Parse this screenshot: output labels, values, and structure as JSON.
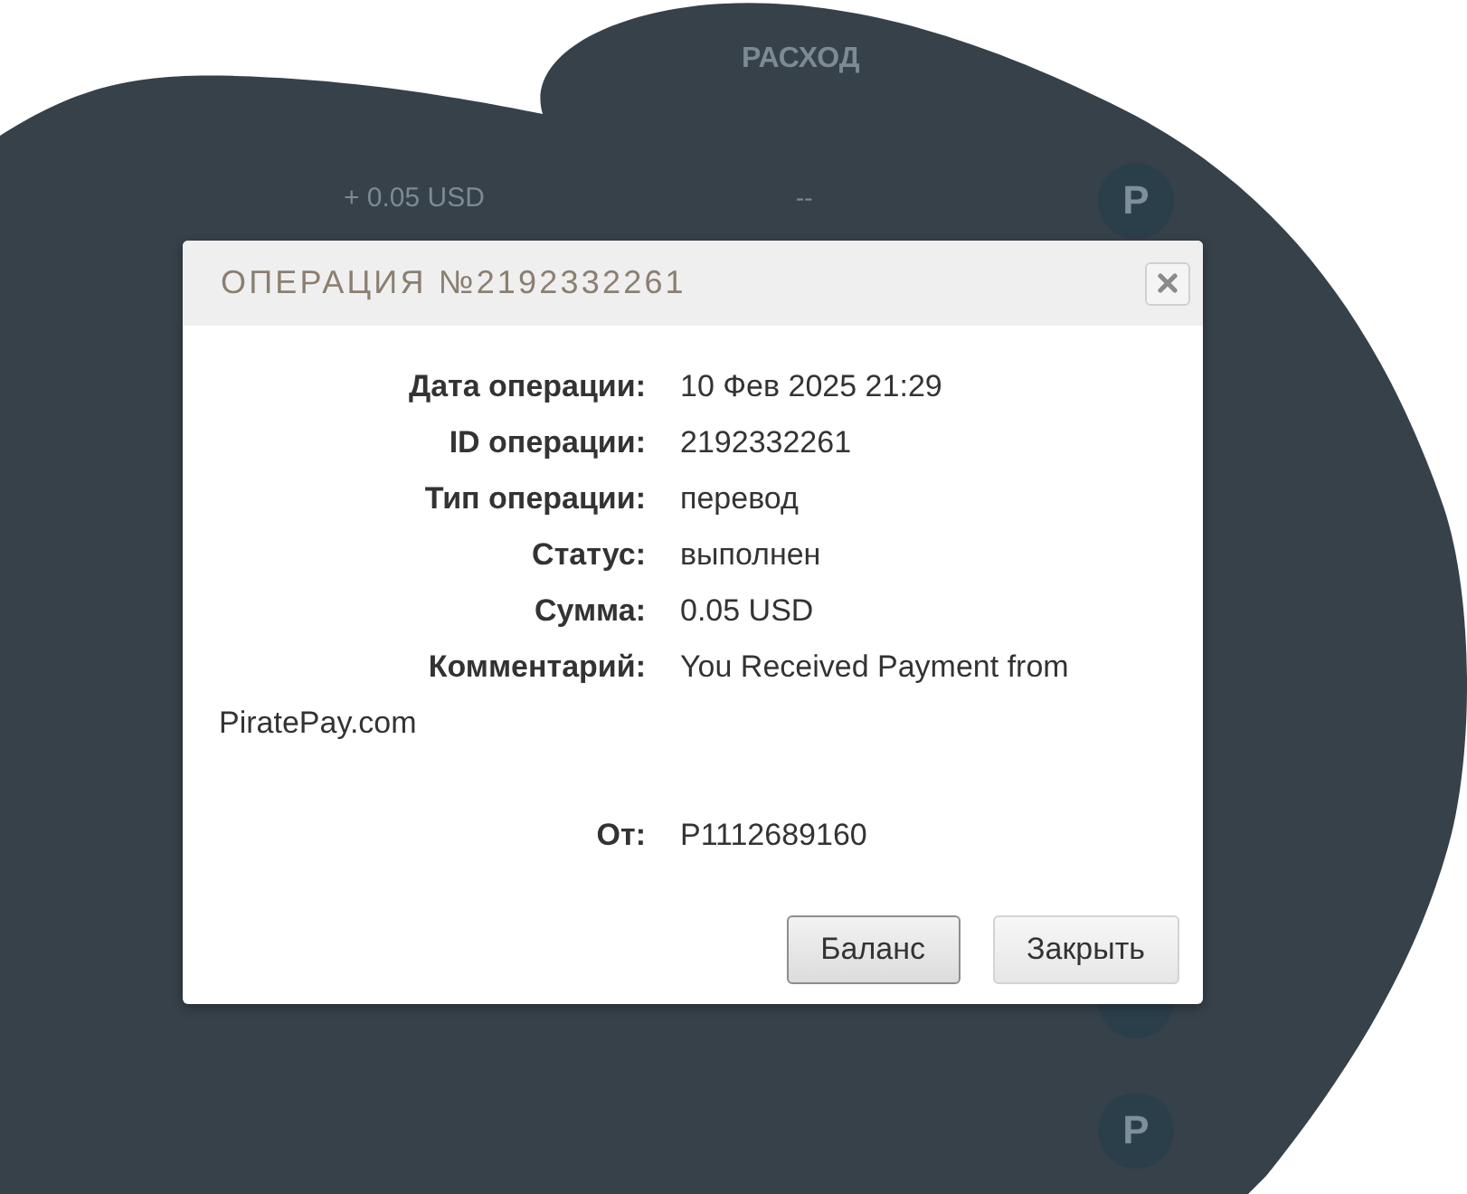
{
  "background": {
    "heading": "РАСХОД",
    "amount": "+ 0.05 USD",
    "dash": "--",
    "badges": [
      "P",
      "P"
    ]
  },
  "dialog": {
    "title": "ОПЕРАЦИЯ №2192332261",
    "fields": [
      {
        "label": "Дата операции:",
        "value": "10 Фев 2025 21:29"
      },
      {
        "label": "ID операции:",
        "value": "2192332261"
      },
      {
        "label": "Тип операции:",
        "value": "перевод"
      },
      {
        "label": "Статус:",
        "value": "выполнен"
      },
      {
        "label": "Сумма:",
        "value": "0.05 USD"
      },
      {
        "label": "Комментарий:",
        "value": "You Received Payment from PiratePay.com"
      }
    ],
    "sender": {
      "label": "От:",
      "value": "P1112689160"
    },
    "buttons": [
      {
        "label": "Баланс",
        "focused": true
      },
      {
        "label": "Закрыть",
        "focused": false
      }
    ]
  }
}
